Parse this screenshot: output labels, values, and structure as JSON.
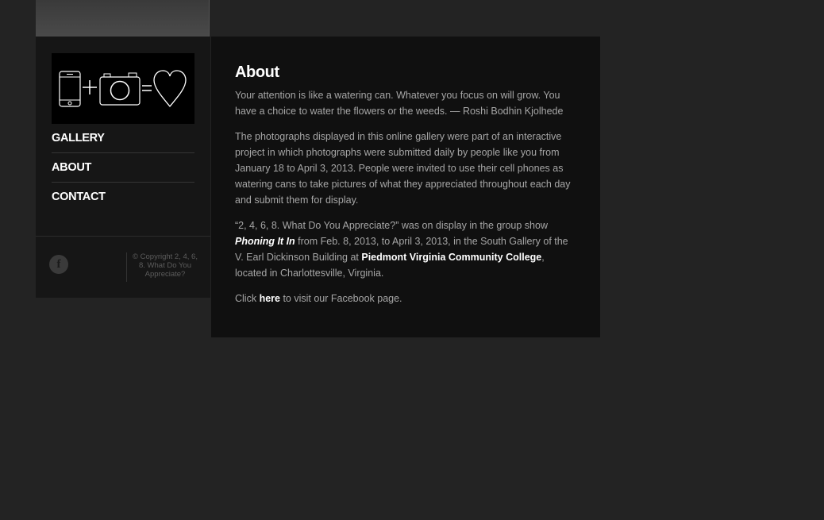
{
  "sidebar": {
    "nav": [
      {
        "label": "GALLERY"
      },
      {
        "label": "ABOUT"
      },
      {
        "label": "CONTACT"
      }
    ],
    "facebook_icon": "facebook-icon",
    "copyright": "© Copyright 2, 4, 6, 8. What Do You Appreciate?"
  },
  "main": {
    "title": "About",
    "quote": "Your attention is like a watering can. Whatever you focus on will grow. You have a choice to water the flowers or the weeds.  — Roshi Bodhin Kjolhede",
    "paragraph1": "The photographs displayed in this online gallery were part of an interactive project in which photographs were submitted daily by people like you from January 18 to April 3, 2013. People were invited to use their cell phones as watering cans to take pictures of what they appreciated throughout each day and submit them for display.",
    "paragraph2_start": "“2, 4, 6, 8. What Do You Appreciate?” was on display in the  group show ",
    "show_title": "Phoning It In",
    "paragraph2_mid": " from Feb. 8, 2013, to April 3, 2013, in the South Gallery of the V. Earl Dickinson Building at ",
    "college_link": "Piedmont Virginia Community College",
    "paragraph2_end": ", located in Charlottesville, Virginia.",
    "click_start": "Click ",
    "here_link": "here",
    "click_end": " to visit our Facebook page."
  },
  "colors": {
    "background": "#232323",
    "sidebar": "#161616",
    "content": "#101010",
    "text": "#a6a6a6",
    "link": "#ffffff"
  }
}
